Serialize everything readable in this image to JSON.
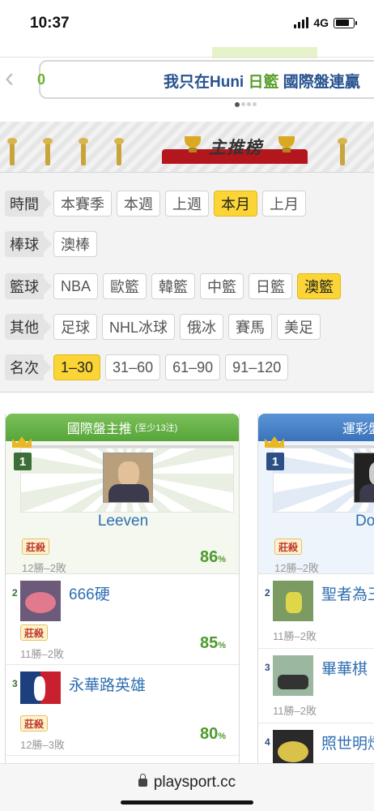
{
  "status": {
    "time": "10:37",
    "network": "4G"
  },
  "banner": {
    "prefix": "0",
    "text_a": "我只在Huni",
    "text_b": "日籃",
    "text_c": "國際盤連贏"
  },
  "section": {
    "title": "主推榜"
  },
  "filters": {
    "time": {
      "label": "時間",
      "options": [
        "本賽季",
        "本週",
        "上週",
        "本月",
        "上月"
      ],
      "selected": "本月"
    },
    "baseball": {
      "label": "棒球",
      "options": [
        "澳棒"
      ]
    },
    "basketball": {
      "label": "籃球",
      "options": [
        "NBA",
        "歐籃",
        "韓籃",
        "中籃",
        "日籃",
        "澳籃"
      ],
      "selected": "澳籃"
    },
    "other": {
      "label": "其他",
      "options": [
        "足球",
        "NHL冰球",
        "俄冰",
        "賽馬",
        "美足"
      ]
    },
    "rank": {
      "label": "名次",
      "options": [
        "1–30",
        "31–60",
        "61–90",
        "91–120"
      ],
      "selected": "1–30"
    }
  },
  "intl": {
    "header": "國際盤主推",
    "header_note": "(至少13注)",
    "top": {
      "rank": "1",
      "name": "Leeven",
      "tag": "莊殺",
      "record": "12勝–2敗",
      "pct": "86"
    },
    "items": [
      {
        "rank": "2",
        "name": "666硬",
        "tag": "莊殺",
        "record": "11勝–2敗",
        "pct": "85"
      },
      {
        "rank": "3",
        "name": "永華路英雄",
        "tag": "莊殺",
        "record": "12勝–3敗",
        "pct": "80"
      }
    ]
  },
  "lottery": {
    "header": "運彩盤主推",
    "top": {
      "rank": "1",
      "name": "Do",
      "tag": "莊殺",
      "record": "12勝–2敗"
    },
    "items": [
      {
        "rank": "2",
        "name": "聖者為王",
        "record": "11勝–2敗"
      },
      {
        "rank": "3",
        "name": "畢華棋",
        "record": "11勝–2敗"
      },
      {
        "rank": "4",
        "name": "照世明燈"
      }
    ]
  },
  "pct_unit": "%",
  "address": {
    "url": "playsport.cc"
  }
}
